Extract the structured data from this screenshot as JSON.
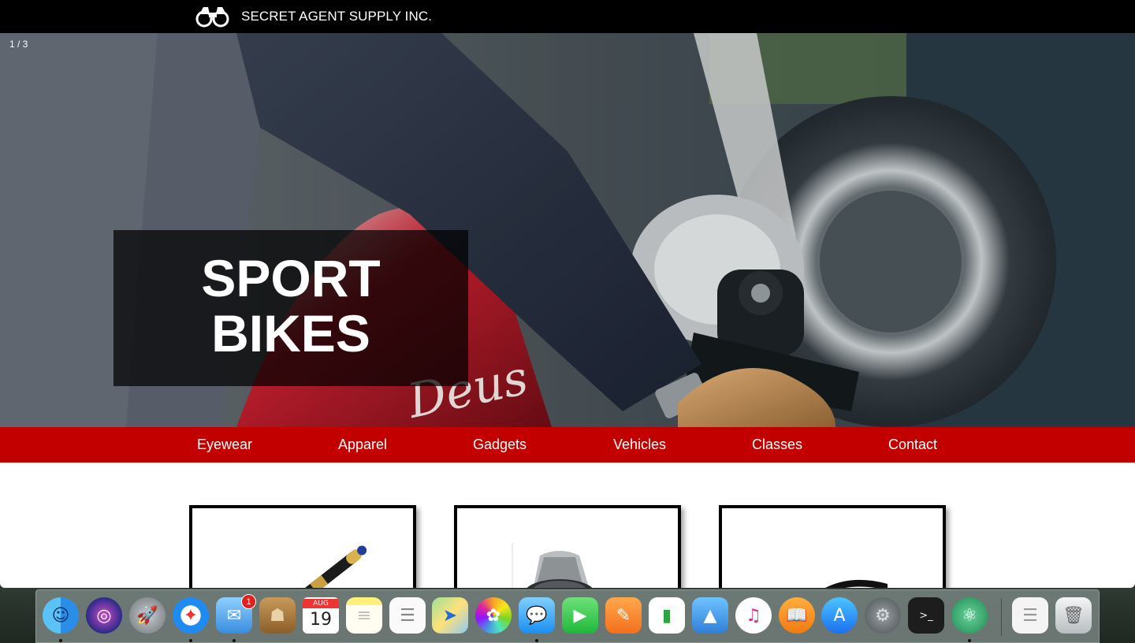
{
  "site": {
    "brand_name": "SECRET AGENT SUPPLY INC.",
    "brand_icon": "binoculars-icon"
  },
  "hero": {
    "slide_counter": "1 / 3",
    "caption_line_1": "SPORT",
    "caption_line_2": "BIKES"
  },
  "nav": {
    "items": [
      {
        "label": "Eyewear"
      },
      {
        "label": "Apparel"
      },
      {
        "label": "Gadgets"
      },
      {
        "label": "Vehicles"
      },
      {
        "label": "Classes"
      },
      {
        "label": "Contact"
      }
    ]
  },
  "products": [
    {
      "image": "pen-image"
    },
    {
      "image": "watch-image"
    },
    {
      "image": "glasses-image"
    }
  ],
  "dock": {
    "apps": [
      {
        "name": "finder-icon",
        "running": true
      },
      {
        "name": "siri-icon",
        "running": false
      },
      {
        "name": "launchpad-icon",
        "running": false
      },
      {
        "name": "safari-icon",
        "running": true
      },
      {
        "name": "mail-icon",
        "running": true,
        "badge": "1"
      },
      {
        "name": "contacts-icon",
        "running": false
      },
      {
        "name": "calendar-icon",
        "running": false,
        "month": "AUG",
        "day": "19"
      },
      {
        "name": "notes-icon",
        "running": false
      },
      {
        "name": "reminders-icon",
        "running": false
      },
      {
        "name": "maps-icon",
        "running": false
      },
      {
        "name": "photos-icon",
        "running": false
      },
      {
        "name": "messages-icon",
        "running": true
      },
      {
        "name": "facetime-icon",
        "running": false
      },
      {
        "name": "pages-icon",
        "running": false
      },
      {
        "name": "numbers-icon",
        "running": false
      },
      {
        "name": "keynote-icon",
        "running": false
      },
      {
        "name": "itunes-icon",
        "running": false
      },
      {
        "name": "ibooks-icon",
        "running": false
      },
      {
        "name": "app-store-icon",
        "running": false
      },
      {
        "name": "system-preferences-icon",
        "running": false
      },
      {
        "name": "terminal-icon",
        "running": false
      },
      {
        "name": "atom-icon",
        "running": true
      },
      {
        "name": "documents-stack-icon",
        "running": false
      },
      {
        "name": "trash-icon",
        "running": false
      }
    ]
  },
  "colors": {
    "nav_red": "#c30000",
    "topbar": "#000000"
  }
}
